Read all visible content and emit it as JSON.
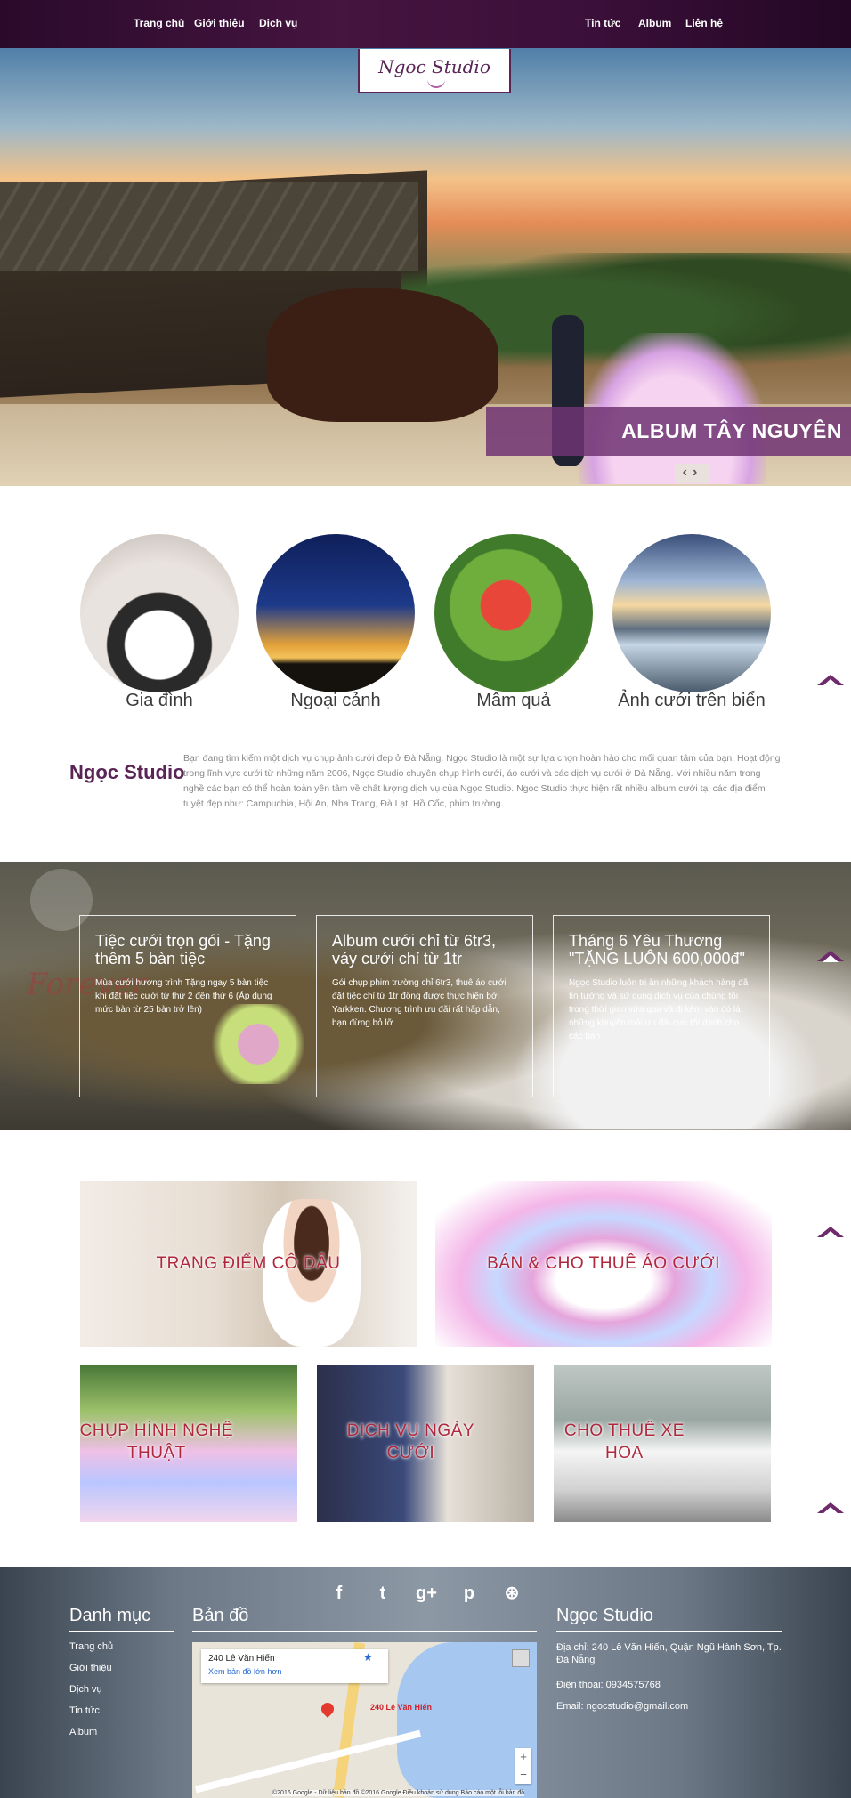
{
  "nav": {
    "left": [
      "Trang chủ",
      "Giới thiệu",
      "Dịch vụ"
    ],
    "right": [
      "Tin tức",
      "Album",
      "Liên hệ"
    ]
  },
  "logo": {
    "text": "Ngoc Studio"
  },
  "hero": {
    "caption": "ALBUM TÂY NGUYÊN",
    "prev_icon": "chevron-left-icon",
    "next_icon": "chevron-right-icon"
  },
  "categories": [
    "Gia đình",
    "Ngoại cảnh",
    "Mâm quả",
    "Ảnh cưới trên biển"
  ],
  "intro": {
    "title": "Ngọc Studio",
    "text": "Bạn đang tìm kiếm một dịch vụ chụp ảnh cưới đẹp ở Đà Nẵng, Ngọc Studio là một sự lựa chọn hoàn hảo cho mối quan tâm của bạn. Hoạt động trong lĩnh vực cưới từ những năm 2006, Ngọc Studio chuyên chụp hình cưới, áo cưới và các dịch vụ cưới ở Đà Nẵng. Với nhiều năm trong nghề các bạn có thể hoàn toàn yên tâm về chất lượng dịch vụ của Ngọc Studio. Ngọc Studio thực hiện rất nhiều album cưới tại các địa điểm tuyệt đẹp như: Campuchia, Hội An, Nha Trang, Đà Lạt, Hồ Cốc, phim trường..."
  },
  "band": {
    "overlay_text": "Forever"
  },
  "promos": [
    {
      "title": "Tiệc cưới trọn gói - Tặng thêm 5 bàn tiệc",
      "text": "Mùa cưới hương trình Tặng ngay 5 bàn tiệc khi đặt tiệc cưới từ thứ 2 đến thứ 6 (Áp dụng mức bàn từ 25 bàn trở lên)"
    },
    {
      "title": "Album cưới chỉ từ 6tr3, váy cưới chỉ từ 1tr",
      "text": "Gói chụp phim trường chỉ 6tr3, thuê áo cưới đặt tiệc chỉ từ 1tr đồng được thực hiện bởi Yarkken. Chương trình ưu đãi rất hấp dẫn, bạn đừng bỏ lỡ"
    },
    {
      "title": "Tháng 6 Yêu Thương \"TẶNG LUÔN 600,000đ\"",
      "text": "Ngọc Studio luôn tri ân những khách hàng đã tin tưởng và sử dụng dịch vụ của chúng tôi trong thời gian vừa qua và đi kèm vào đó là những khuyến mãi ưu đãi cực tốt dành cho các bạn"
    }
  ],
  "services": [
    "TRANG ĐIỂM CÔ DÂU",
    "BÁN & CHO THUÊ ÁO CƯỚI",
    "CHỤP HÌNH NGHỆ THUẬT",
    "DỊCH VỤ NGÀY CƯỚI",
    "CHO THUÊ XE HOA"
  ],
  "footer": {
    "social_icons": [
      "facebook-icon",
      "twitter-icon",
      "google-plus-icon",
      "pinterest-icon",
      "dribbble-icon"
    ],
    "social_glyphs": [
      "f",
      "t",
      "g+",
      "p",
      "⊛"
    ],
    "menu_title": "Danh mục",
    "menu": [
      "Trang chủ",
      "Giới thiệu",
      "Dịch vụ",
      "Tin tức",
      "Album"
    ],
    "map_title": "Bản đồ",
    "map": {
      "address": "240 Lê Văn Hiến",
      "link": "Xem bản đồ lớn hơn",
      "pin_label": "240 Lê Văn Hiến",
      "credit": "©2016 Google - Dữ liệu bản đồ ©2016 Google   Điều khoản sử dụng   Báo cáo một lỗi bản đồ"
    },
    "info_title": "Ngọc Studio",
    "info": {
      "address": "Địa chỉ: 240 Lê Văn Hiến, Quận Ngũ Hành Sơn, Tp. Đà Nẵng",
      "phone": "Điện thoại: 0934575768",
      "email": "Email: ngocstudio@gmail.com"
    }
  }
}
